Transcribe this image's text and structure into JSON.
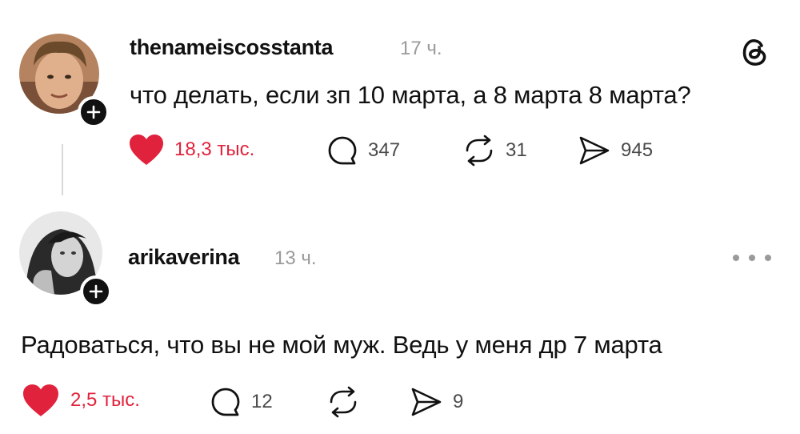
{
  "posts": [
    {
      "username": "thenameiscosstanta",
      "time": "17 ч.",
      "text": "что делать, если зп 10 марта, а 8 марта 8 марта?",
      "likes": "18,3 тыс.",
      "replies": "347",
      "reposts": "31",
      "shares": "945",
      "liked": true,
      "icons": [
        "heart-icon",
        "comment-icon",
        "repost-icon",
        "share-icon",
        "threads-logo-icon",
        "plus-icon"
      ]
    },
    {
      "username": "arikaverina",
      "time": "13 ч.",
      "text": "Радоваться, что вы не мой муж. Ведь у меня др 7 марта",
      "likes": "2,5 тыс.",
      "replies": "12",
      "reposts": "",
      "shares": "9",
      "liked": true,
      "icons": [
        "heart-icon",
        "comment-icon",
        "repost-icon",
        "share-icon",
        "more-icon",
        "plus-icon"
      ]
    }
  ],
  "colors": {
    "like_red": "#e1223c",
    "text_dark": "#111111",
    "muted_gray": "#9a9a9a",
    "icon_gray": "#4a4a4a"
  }
}
